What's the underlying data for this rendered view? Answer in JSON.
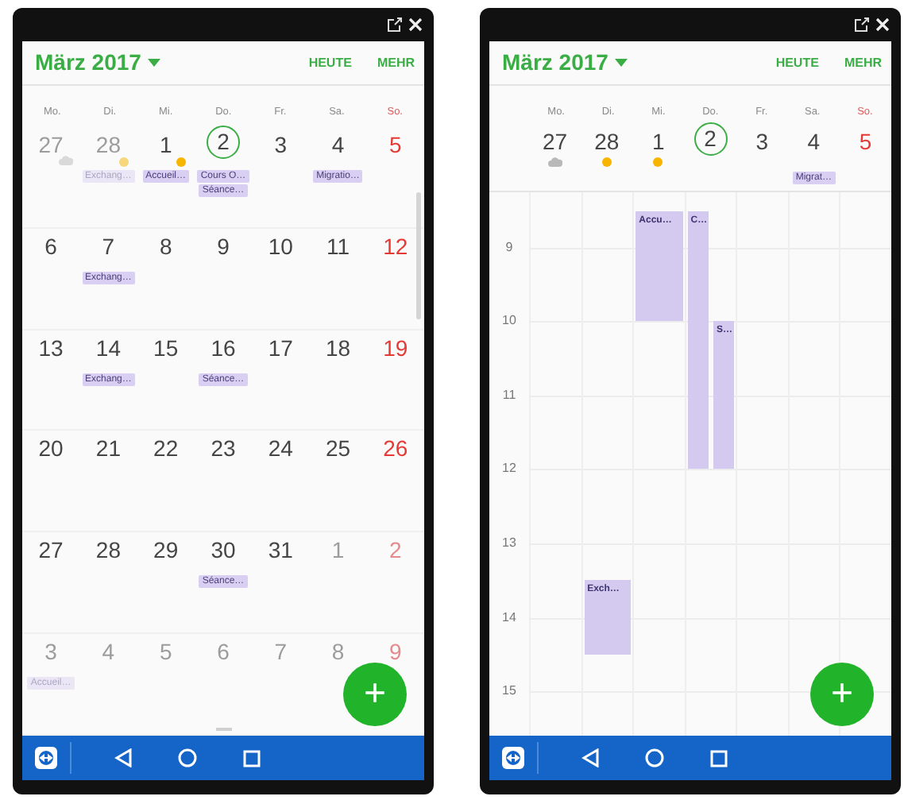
{
  "phones": [
    {
      "kind": "month",
      "title": "März 2017",
      "actions": [
        "HEUTE",
        "MEHR"
      ],
      "weekdays": [
        "Mo.",
        "Di.",
        "Mi.",
        "Do.",
        "Fr.",
        "Sa.",
        "So."
      ],
      "weeks": [
        {
          "days": [
            {
              "number": "27",
              "outside_month": true,
              "today": false,
              "weather": {
                "kind": "cloud"
              }
            },
            {
              "number": "28",
              "outside_month": true,
              "today": false,
              "weather": {
                "kind": "sun"
              },
              "events": [
                "Exchang…"
              ]
            },
            {
              "number": "1",
              "outside_month": false,
              "today": false,
              "weather": {
                "kind": "sun"
              },
              "events": [
                "Accueil…"
              ]
            },
            {
              "number": "2",
              "outside_month": false,
              "today": true,
              "events": [
                "Cours O…",
                "Séance…"
              ]
            },
            {
              "number": "3",
              "outside_month": false,
              "today": false
            },
            {
              "number": "4",
              "outside_month": false,
              "today": false,
              "events": [
                "Migratio…"
              ]
            },
            {
              "number": "5",
              "outside_month": false,
              "today": false
            }
          ]
        },
        {
          "days": [
            {
              "number": "6",
              "outside_month": false,
              "today": false
            },
            {
              "number": "7",
              "outside_month": false,
              "today": false,
              "events": [
                "Exchang…"
              ]
            },
            {
              "number": "8",
              "outside_month": false,
              "today": false
            },
            {
              "number": "9",
              "outside_month": false,
              "today": false
            },
            {
              "number": "10",
              "outside_month": false,
              "today": false
            },
            {
              "number": "11",
              "outside_month": false,
              "today": false
            },
            {
              "number": "12",
              "outside_month": false,
              "today": false
            }
          ]
        },
        {
          "days": [
            {
              "number": "13",
              "outside_month": false,
              "today": false
            },
            {
              "number": "14",
              "outside_month": false,
              "today": false,
              "events": [
                "Exchang…"
              ]
            },
            {
              "number": "15",
              "outside_month": false,
              "today": false
            },
            {
              "number": "16",
              "outside_month": false,
              "today": false,
              "events": [
                "Séance…"
              ]
            },
            {
              "number": "17",
              "outside_month": false,
              "today": false
            },
            {
              "number": "18",
              "outside_month": false,
              "today": false
            },
            {
              "number": "19",
              "outside_month": false,
              "today": false
            }
          ]
        },
        {
          "days": [
            {
              "number": "20",
              "outside_month": false,
              "today": false
            },
            {
              "number": "21",
              "outside_month": false,
              "today": false
            },
            {
              "number": "22",
              "outside_month": false,
              "today": false
            },
            {
              "number": "23",
              "outside_month": false,
              "today": false
            },
            {
              "number": "24",
              "outside_month": false,
              "today": false
            },
            {
              "number": "25",
              "outside_month": false,
              "today": false
            },
            {
              "number": "26",
              "outside_month": false,
              "today": false
            }
          ]
        },
        {
          "days": [
            {
              "number": "27",
              "outside_month": false,
              "today": false
            },
            {
              "number": "28",
              "outside_month": false,
              "today": false
            },
            {
              "number": "29",
              "outside_month": false,
              "today": false
            },
            {
              "number": "30",
              "outside_month": false,
              "today": false,
              "events": [
                "Séance…"
              ]
            },
            {
              "number": "31",
              "outside_month": false,
              "today": false
            },
            {
              "number": "1",
              "outside_month": true,
              "today": false
            },
            {
              "number": "2",
              "outside_month": true,
              "today": false
            }
          ]
        },
        {
          "days": [
            {
              "number": "3",
              "outside_month": true,
              "today": false,
              "events": [
                "Accueil…"
              ]
            },
            {
              "number": "4",
              "outside_month": true,
              "today": false
            },
            {
              "number": "5",
              "outside_month": true,
              "today": false
            },
            {
              "number": "6",
              "outside_month": true,
              "today": false
            },
            {
              "number": "7",
              "outside_month": true,
              "today": false
            },
            {
              "number": "8",
              "outside_month": true,
              "today": false
            },
            {
              "number": "9",
              "outside_month": true,
              "today": false
            }
          ]
        }
      ],
      "fab": "+"
    },
    {
      "kind": "week",
      "title": "März 2017",
      "actions": [
        "HEUTE",
        "MEHR"
      ],
      "weekdays": [
        "Mo.",
        "Di.",
        "Mi.",
        "Do.",
        "Fr.",
        "Sa.",
        "So."
      ],
      "days": [
        {
          "number": "27",
          "today": false,
          "weather": {
            "kind": "cloud"
          }
        },
        {
          "number": "28",
          "today": false,
          "weather": {
            "kind": "sun"
          },
          "events": [
            {
              "title": "Exch…"
            }
          ]
        },
        {
          "number": "1",
          "today": false,
          "weather": {
            "kind": "sun"
          },
          "events": [
            {
              "title": "Accu…"
            }
          ]
        },
        {
          "number": "2",
          "today": true,
          "events": [
            {
              "title": "C…"
            },
            {
              "title": "S…"
            }
          ]
        },
        {
          "number": "3",
          "today": false
        },
        {
          "number": "4",
          "today": false,
          "all_day": [
            "Migrat…"
          ]
        },
        {
          "number": "5",
          "today": false
        }
      ],
      "hours": [
        "9",
        "10",
        "11",
        "12",
        "13",
        "14",
        "15"
      ],
      "fab": "+"
    }
  ]
}
